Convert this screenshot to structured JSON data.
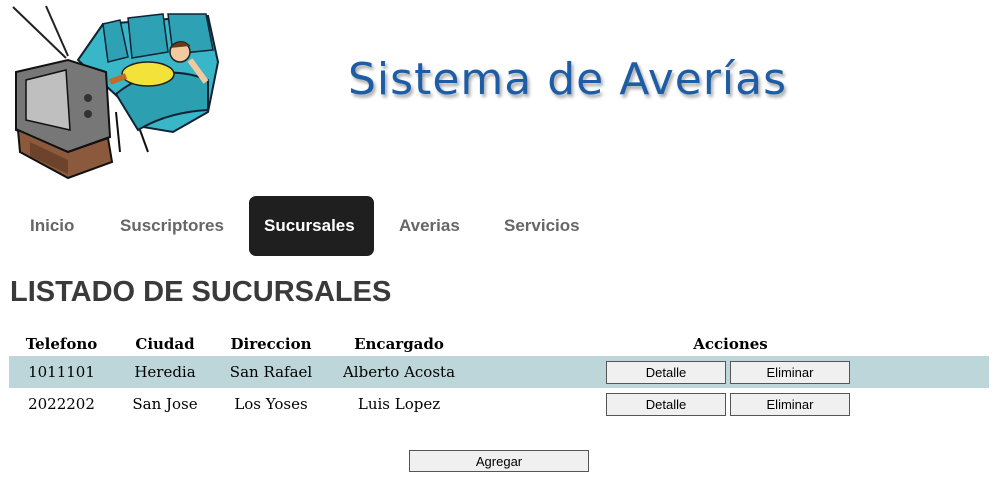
{
  "header": {
    "title": "Sistema de Averías"
  },
  "nav": {
    "items": [
      {
        "label": "Inicio",
        "active": false
      },
      {
        "label": "Suscriptores",
        "active": false
      },
      {
        "label": "Sucursales",
        "active": true
      },
      {
        "label": "Averias",
        "active": false
      },
      {
        "label": "Servicios",
        "active": false
      }
    ]
  },
  "page": {
    "heading": "LISTADO DE SUCURSALES"
  },
  "table": {
    "columns": {
      "telefono": "Telefono",
      "ciudad": "Ciudad",
      "direccion": "Direccion",
      "encargado": "Encargado",
      "acciones": "Acciones"
    },
    "rows": [
      {
        "telefono": "1011101",
        "ciudad": "Heredia",
        "direccion": "San Rafael",
        "encargado": "Alberto Acosta"
      },
      {
        "telefono": "2022202",
        "ciudad": "San Jose",
        "direccion": "Los Yoses",
        "encargado": "Luis Lopez"
      }
    ],
    "row_actions": {
      "detail": "Detalle",
      "delete": "Eliminar"
    }
  },
  "add_button": "Agregar",
  "colors": {
    "brand": "#1d5da6",
    "active_tab": "#1f1f1f",
    "row_highlight": "#bcd6d9"
  }
}
